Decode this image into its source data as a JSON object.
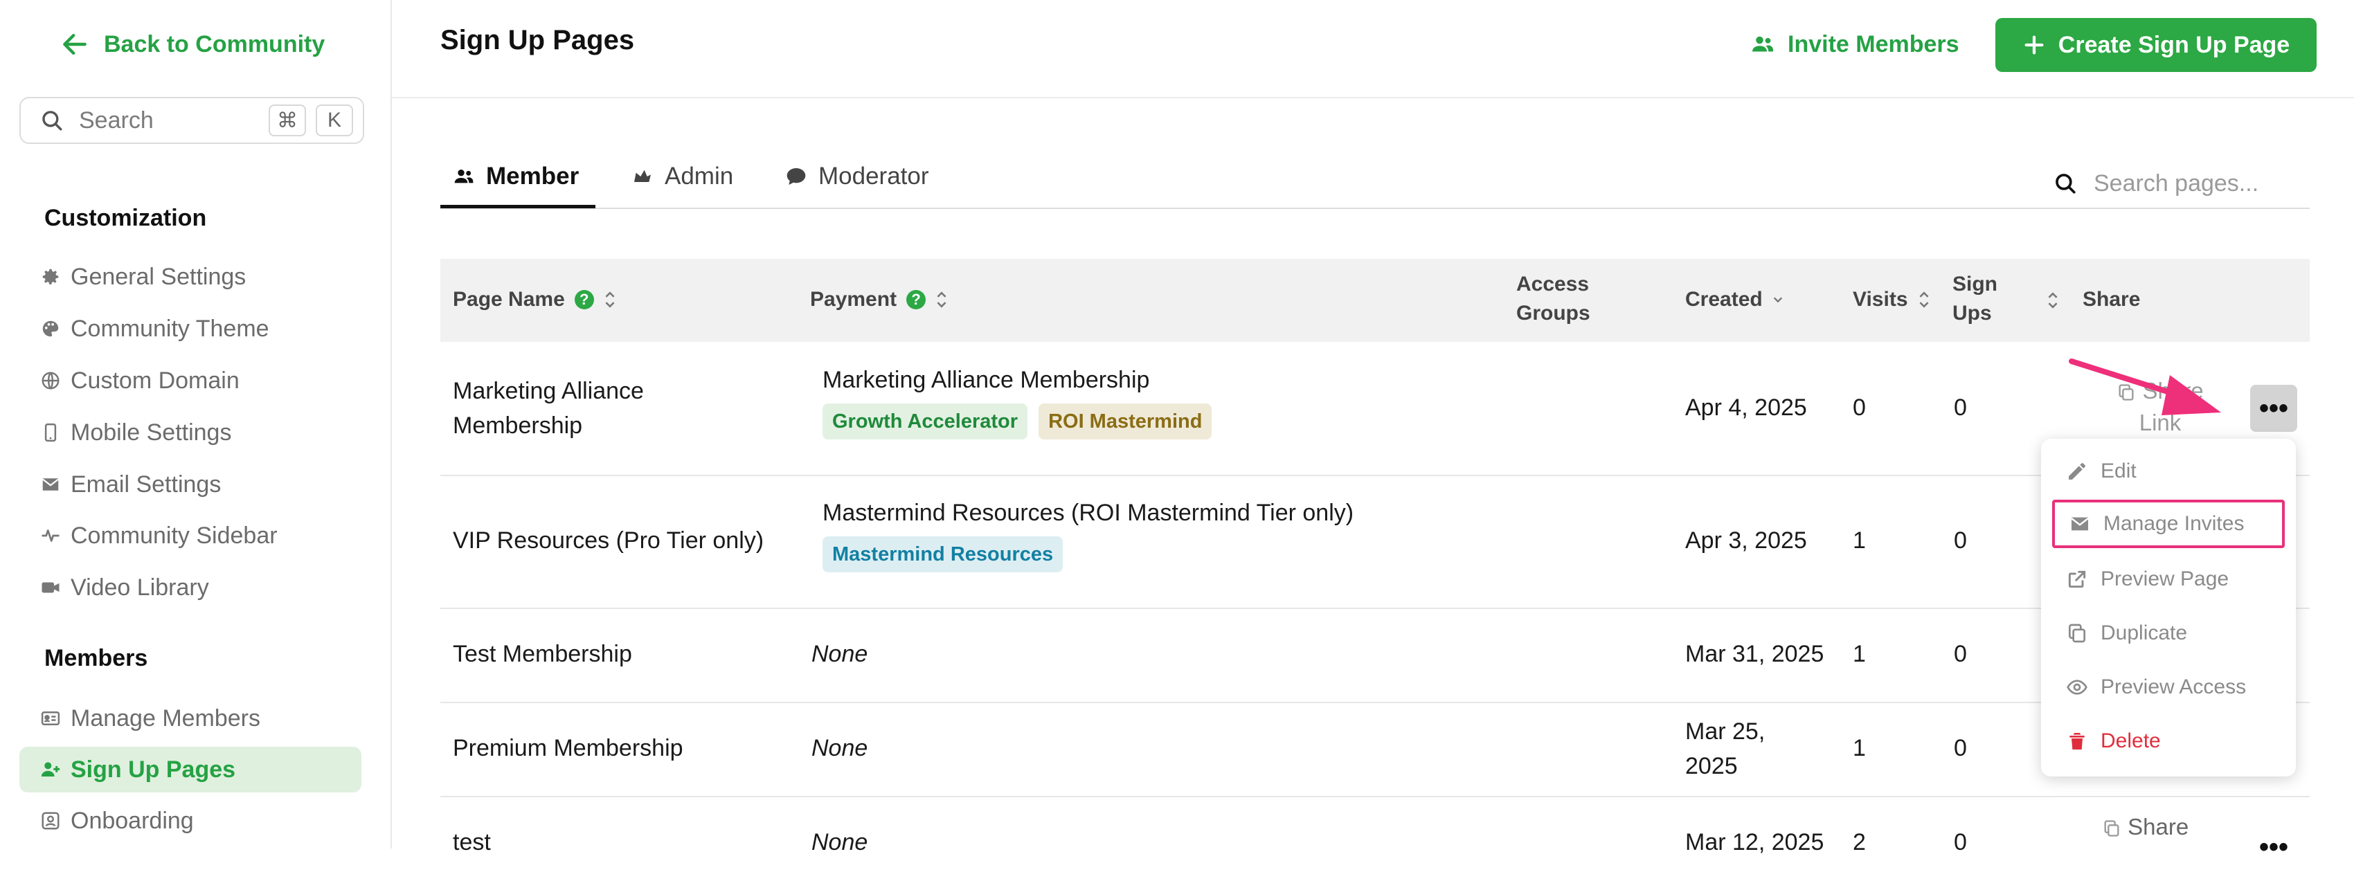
{
  "sidebar": {
    "back_label": "Back to Community",
    "search": {
      "placeholder": "Search",
      "key1": "⌘",
      "key2": "K"
    },
    "sections": {
      "customization": "Customization",
      "members": "Members"
    },
    "customization_items": [
      {
        "label": "General Settings",
        "icon": "gear-icon"
      },
      {
        "label": "Community Theme",
        "icon": "palette-icon"
      },
      {
        "label": "Custom Domain",
        "icon": "globe-icon"
      },
      {
        "label": "Mobile Settings",
        "icon": "mobile-icon"
      },
      {
        "label": "Email Settings",
        "icon": "envelope-icon"
      },
      {
        "label": "Community Sidebar",
        "icon": "pulse-icon"
      },
      {
        "label": "Video Library",
        "icon": "video-icon"
      }
    ],
    "member_items": [
      {
        "label": "Manage Members",
        "icon": "id-card-icon"
      },
      {
        "label": "Sign Up Pages",
        "icon": "user-plus-icon",
        "active": true
      },
      {
        "label": "Onboarding",
        "icon": "onboarding-icon"
      }
    ]
  },
  "header": {
    "title": "Sign Up Pages",
    "invite_label": "Invite Members",
    "create_label": "Create Sign Up Page"
  },
  "tabs": [
    {
      "label": "Member",
      "active": true
    },
    {
      "label": "Admin"
    },
    {
      "label": "Moderator"
    }
  ],
  "page_search": {
    "placeholder": "Search pages..."
  },
  "table": {
    "columns": {
      "page_name": "Page Name",
      "payment": "Payment",
      "access_groups_1": "Access",
      "access_groups_2": "Groups",
      "created": "Created",
      "visits": "Visits",
      "signups_1": "Sign",
      "signups_2": "Ups",
      "share": "Share"
    },
    "help_glyph": "?",
    "rows": [
      {
        "name_1": "Marketing Alliance",
        "name_2": "Membership",
        "payment": "Marketing Alliance Membership",
        "tags": [
          "Growth Accelerator",
          "ROI Mastermind"
        ],
        "created": "Apr 4, 2025",
        "visits": "0",
        "signups": "0",
        "share_1": "Share",
        "share_2": "Link"
      },
      {
        "name": "VIP Resources (Pro Tier only)",
        "payment": "Mastermind Resources (ROI Mastermind Tier only)",
        "tags": [
          "Mastermind Resources"
        ],
        "created": "Apr 3, 2025",
        "visits": "1",
        "signups": "0"
      },
      {
        "name": "Test Membership",
        "payment": "None",
        "created": "Mar 31, 2025",
        "visits": "1",
        "signups": "0"
      },
      {
        "name": "Premium Membership",
        "payment": "None",
        "created_1": "Mar 25,",
        "created_2": "2025",
        "visits": "1",
        "signups": "0"
      },
      {
        "name": "test",
        "payment": "None",
        "created": "Mar 12, 2025",
        "visits": "2",
        "signups": "0",
        "share": "Share"
      }
    ],
    "more_glyph": "•••"
  },
  "row_menu": {
    "items": [
      {
        "label": "Edit",
        "icon": "pencil-icon"
      },
      {
        "label": "Manage Invites",
        "icon": "envelope-icon",
        "highlighted": true
      },
      {
        "label": "Preview Page",
        "icon": "external-link-icon"
      },
      {
        "label": "Duplicate",
        "icon": "copy-icon"
      },
      {
        "label": "Preview Access",
        "icon": "eye-icon"
      },
      {
        "label": "Delete",
        "icon": "trash-icon",
        "danger": true
      }
    ]
  },
  "colors": {
    "brand_green": "#2ca844",
    "tag_green_bg": "#e3f1e3",
    "tag_green_fg": "#1f8a3a",
    "tag_gold_bg": "#efe9d8",
    "tag_gold_fg": "#8a6d14",
    "tag_blue_bg": "#ddeef3",
    "tag_blue_fg": "#1380a3",
    "highlight_pink": "#e8317a",
    "danger_red": "#e02d3c"
  }
}
